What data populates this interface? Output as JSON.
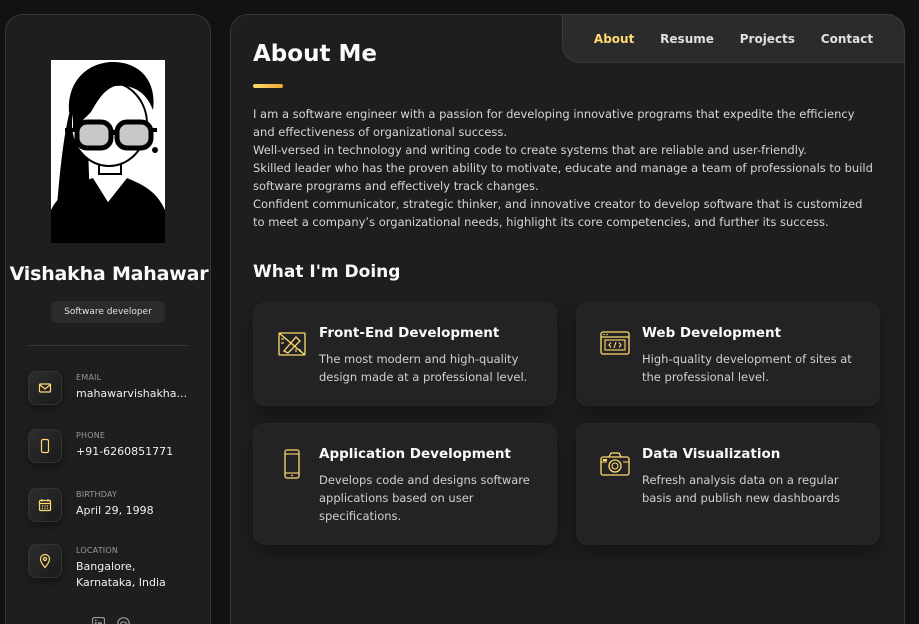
{
  "profile": {
    "name": "Vishakha Mahawar",
    "title": "Software developer"
  },
  "contacts": [
    {
      "label": "EMAIL",
      "value": "mahawarvishakha...",
      "icon": "mail-icon"
    },
    {
      "label": "PHONE",
      "value": "+91-6260851771",
      "icon": "phone-icon"
    },
    {
      "label": "BIRTHDAY",
      "value": "April 29, 1998",
      "icon": "calendar-icon"
    },
    {
      "label": "LOCATION",
      "value": "Bangalore, Karnataka, India",
      "icon": "location-icon"
    }
  ],
  "social": [
    "linkedin-icon",
    "github-icon"
  ],
  "nav": {
    "items": [
      "About",
      "Resume",
      "Projects",
      "Contact"
    ],
    "active": "About"
  },
  "about": {
    "heading": "About Me",
    "paragraphs": [
      "I am a software engineer with a passion for developing innovative programs that expedite the efficiency and effectiveness of organizational success.",
      "Well-versed in technology and writing code to create systems that are reliable and user-friendly.",
      "Skilled leader who has the proven ability to motivate, educate and manage a team of professionals to build software programs and effectively track changes.",
      "Confident communicator, strategic thinker, and innovative creator to develop software that is customized to meet a company’s organizational needs, highlight its core competencies, and further its success."
    ]
  },
  "services": {
    "heading": "What I'm Doing",
    "items": [
      {
        "title": "Front-End Development",
        "text": "The most modern and high-quality design made at a professional level.",
        "icon": "design-tools-icon"
      },
      {
        "title": "Web Development",
        "text": "High-quality development of sites at the professional level.",
        "icon": "code-window-icon"
      },
      {
        "title": "Application Development",
        "text": "Develops code and designs software applications based on user specifications.",
        "icon": "mobile-phone-icon"
      },
      {
        "title": "Data Visualization",
        "text": "Refresh analysis data on a regular basis and publish new dashboards",
        "icon": "camera-icon"
      }
    ]
  },
  "colors": {
    "accent": "#ffdb70",
    "background": "#121212",
    "panel": "#1e1e1f"
  }
}
